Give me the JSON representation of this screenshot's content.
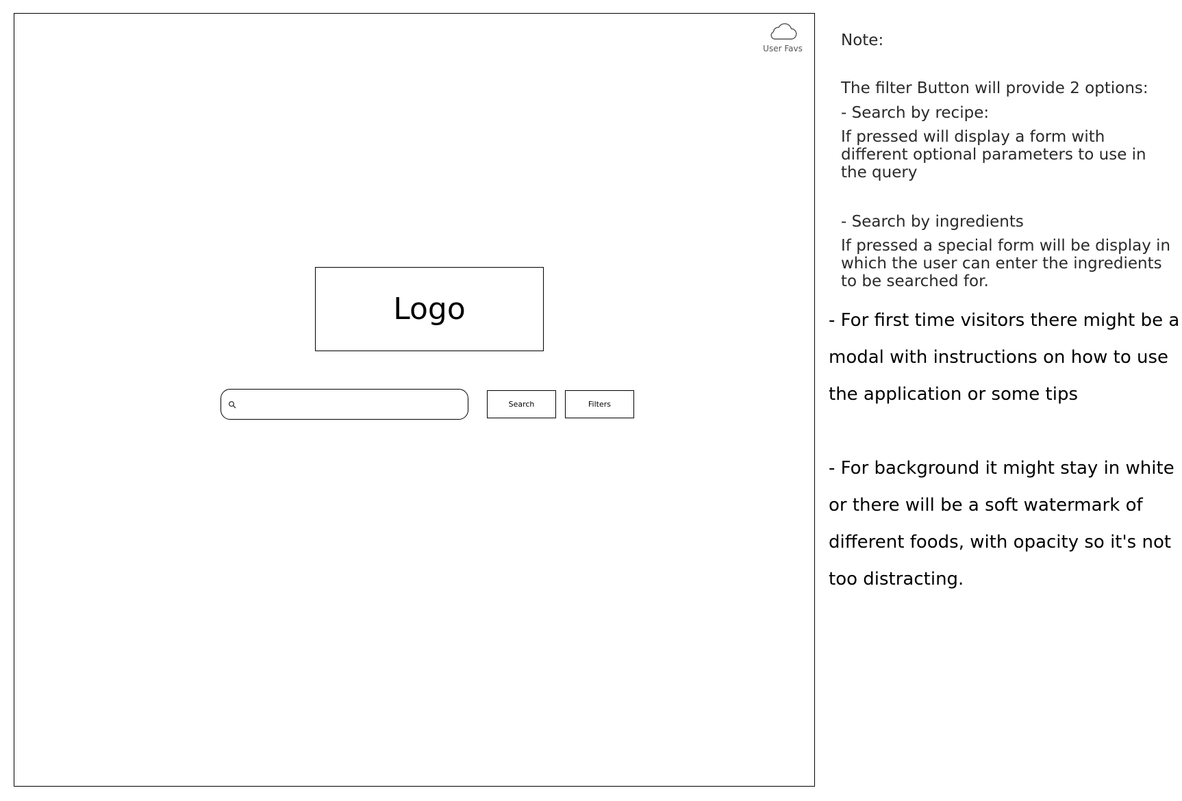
{
  "wireframe": {
    "user_favs": {
      "label": "User Favs",
      "icon": "cloud-icon"
    },
    "logo": {
      "text": "Logo"
    },
    "search": {
      "placeholder": "",
      "value": "",
      "icon": "search-icon"
    },
    "buttons": {
      "search_label": "Search",
      "filters_label": "Filters"
    }
  },
  "notes": {
    "title": "Note:",
    "intro": "The filter Button will provide 2 options:",
    "recipe_heading": "- Search by recipe:",
    "recipe_description": "If pressed will display a form with different optional parameters to use in the query",
    "ingredients_heading": "- Search by ingredients",
    "ingredients_description": "If pressed a special form will be display in which the user can enter the ingredients to be searched for.",
    "first_time_visitors": "- For first time visitors there might be a modal with instructions on how to use the application or some tips",
    "background": "- For background it might stay in white or there will be a soft watermark of different foods, with opacity so it's not too distracting."
  }
}
